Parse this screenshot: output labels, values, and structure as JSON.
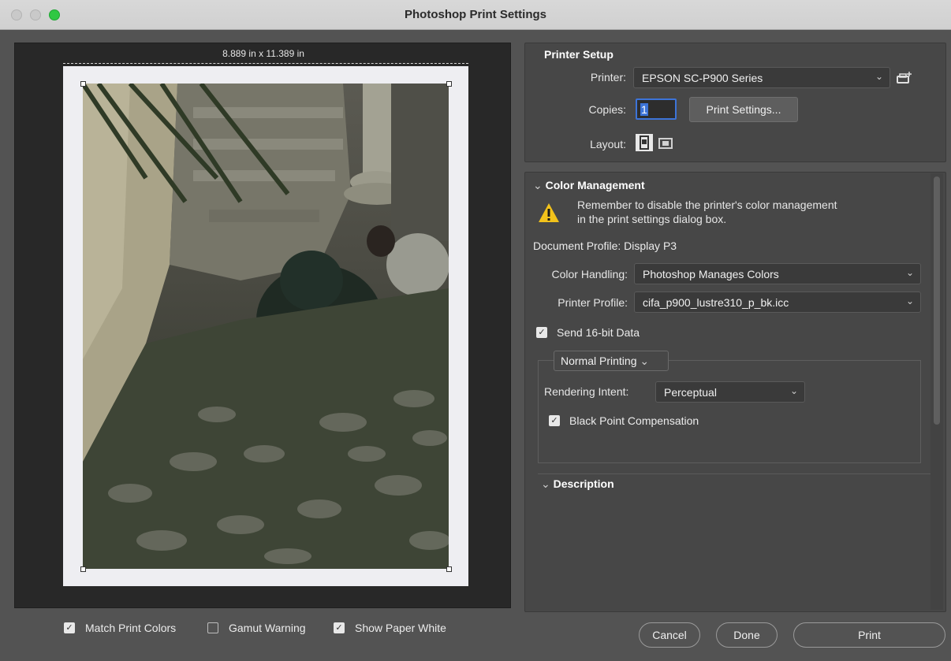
{
  "window": {
    "title": "Photoshop Print Settings"
  },
  "preview": {
    "dimensions": "8.889 in x 11.389 in"
  },
  "printer_setup": {
    "title": "Printer Setup",
    "printer_label": "Printer:",
    "printer_value": "EPSON SC-P900 Series",
    "copies_label": "Copies:",
    "copies_value": "1",
    "print_settings_button": "Print Settings...",
    "layout_label": "Layout:"
  },
  "color_management": {
    "title": "Color Management",
    "warning": "Remember to disable the printer's color management in the print settings dialog box.",
    "document_profile": "Document Profile: Display P3",
    "color_handling_label": "Color Handling:",
    "color_handling_value": "Photoshop Manages Colors",
    "printer_profile_label": "Printer Profile:",
    "printer_profile_value": "cifa_p900_lustre310_p_bk.icc",
    "send_16bit_label": "Send 16-bit Data",
    "normal_printing": "Normal Printing",
    "rendering_intent_label": "Rendering Intent:",
    "rendering_intent_value": "Perceptual",
    "bpc_label": "Black Point Compensation"
  },
  "description": {
    "title": "Description"
  },
  "bottom": {
    "match_print_colors": "Match Print Colors",
    "gamut_warning": "Gamut Warning",
    "show_paper_white": "Show Paper White",
    "cancel": "Cancel",
    "done": "Done",
    "print": "Print"
  },
  "checkbox_states": {
    "match_print_colors": true,
    "gamut_warning": false,
    "show_paper_white": true,
    "send_16bit": true,
    "bpc": true
  },
  "colors": {
    "accent": "#3d74d8",
    "panel": "#474747",
    "background": "#535353"
  }
}
